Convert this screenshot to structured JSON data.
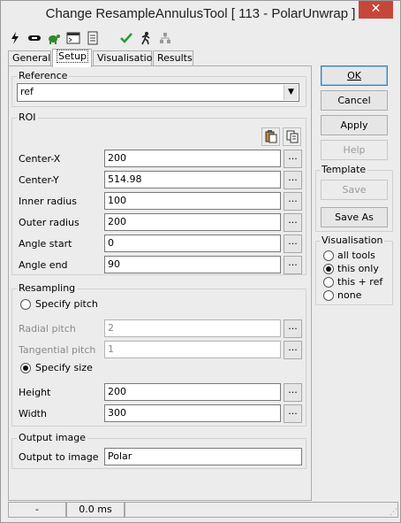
{
  "window": {
    "title": "Change ResampleAnnulusTool [ 113 - PolarUnwrap ]",
    "close_glyph": "✕"
  },
  "toolbar": {
    "icons": [
      "lightning-icon",
      "link-icon",
      "turtle-icon",
      "console-icon",
      "list-icon",
      "checkmark-icon",
      "run-person-icon",
      "network-icon"
    ]
  },
  "tabs": [
    {
      "label": "General"
    },
    {
      "label": "Setup"
    },
    {
      "label": "Visualisation"
    },
    {
      "label": "Results"
    }
  ],
  "reference": {
    "legend": "Reference",
    "value": "ref"
  },
  "roi": {
    "legend": "ROI",
    "fields": [
      {
        "label": "Center-X",
        "value": "200"
      },
      {
        "label": "Center-Y",
        "value": "514.98"
      },
      {
        "label": "Inner radius",
        "value": "100"
      },
      {
        "label": "Outer radius",
        "value": "200"
      },
      {
        "label": "Angle start",
        "value": "0"
      },
      {
        "label": "Angle end",
        "value": "90"
      }
    ]
  },
  "resampling": {
    "legend": "Resampling",
    "specify_pitch": "Specify pitch",
    "radial_pitch_label": "Radial pitch",
    "radial_pitch_value": "2",
    "tangential_pitch_label": "Tangential pitch",
    "tangential_pitch_value": "1",
    "specify_size": "Specify size",
    "height_label": "Height",
    "height_value": "200",
    "width_label": "Width",
    "width_value": "300"
  },
  "output": {
    "legend": "Output image",
    "label": "Output to image",
    "value": "Polar"
  },
  "ellipsis": "...",
  "buttons": {
    "ok": "OK",
    "cancel": "Cancel",
    "apply": "Apply",
    "help": "Help"
  },
  "template": {
    "legend": "Template",
    "save": "Save",
    "save_as": "Save As"
  },
  "visualisation": {
    "legend": "Visualisation",
    "options": [
      "all tools",
      "this only",
      "this + ref",
      "none"
    ],
    "selected": "this only"
  },
  "status": {
    "cell1": "-",
    "cell2": "0.0 ms"
  }
}
